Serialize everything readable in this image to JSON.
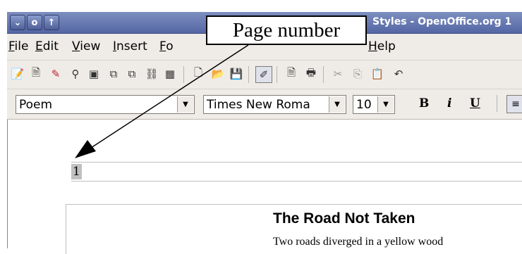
{
  "window": {
    "title": "Styles - OpenOffice.org 1"
  },
  "menubar": {
    "items": [
      {
        "label": "File",
        "accel": "F",
        "rest": "ile"
      },
      {
        "label": "Edit",
        "accel": "E",
        "rest": "dit"
      },
      {
        "label": "View",
        "accel": "V",
        "rest": "iew"
      },
      {
        "label": "Insert",
        "accel": "I",
        "rest": "nsert"
      },
      {
        "label": "Format",
        "accel": "F",
        "rest": "o"
      },
      {
        "label": "Help",
        "accel": "H",
        "rest": "elp"
      }
    ]
  },
  "formatting": {
    "paragraph_style": "Poem",
    "font_name": "Times New Roma",
    "font_size": "10",
    "bold_label": "B",
    "italic_label": "i",
    "underline_label": "U"
  },
  "document": {
    "page_number": "1",
    "poem_title": "The Road Not Taken",
    "poem_line_1": "Two roads diverged in a yellow wood"
  },
  "callout": {
    "label": "Page number"
  },
  "icons": {
    "toolbar": [
      "new-document-icon",
      "template-icon",
      "edit-file-icon",
      "find-icon",
      "navigator-icon",
      "gallery-icon",
      "datasource-icon",
      "hyperlink-icon",
      "field-icon",
      "new-icon",
      "open-icon",
      "save-icon",
      "edit-mode-icon",
      "export-pdf-icon",
      "print-icon",
      "cut-icon",
      "copy-icon",
      "paste-icon"
    ]
  },
  "colors": {
    "titlebar": "#5466a4",
    "chrome": "#efebe7",
    "field_shading": "#c0c0c0"
  }
}
